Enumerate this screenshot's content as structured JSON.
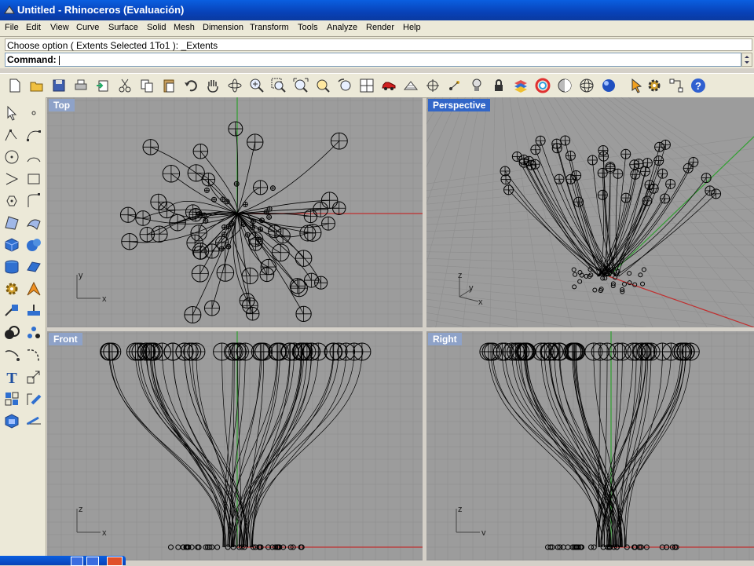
{
  "window": {
    "title": "Untitled - Rhinoceros (Evaluación)"
  },
  "menu": [
    "File",
    "Edit",
    "View",
    "Curve",
    "Surface",
    "Solid",
    "Mesh",
    "Dimension",
    "Transform",
    "Tools",
    "Analyze",
    "Render",
    "Help"
  ],
  "command": {
    "history": "Choose option ( Extents  Selected  1To1 ): _Extents",
    "prompt_label": "Command:",
    "value": ""
  },
  "toolbar_icons": [
    "new-icon",
    "open-icon",
    "save-icon",
    "print-icon",
    "import-icon",
    "cut-icon",
    "copy-icon",
    "paste-icon",
    "undo-icon",
    "pan-hand-icon",
    "rotate-view-icon",
    "zoom-in-icon",
    "zoom-window-icon",
    "zoom-extents-icon",
    "zoom-selected-icon",
    "undo-view-icon",
    "four-viewports-icon",
    "car-icon",
    "grid-icon",
    "osnap-icon",
    "points-icon",
    "light-icon",
    "lock-icon",
    "layer-icon",
    "color-wheel-icon",
    "shade-icon",
    "wireframe-sphere-icon",
    "render-sphere-icon",
    "select-arrow-icon",
    "settings-gear-icon",
    "history-icon",
    "help-icon"
  ],
  "left_toolbar_icons": [
    "select-arrow-icon",
    "point-icon",
    "polyline-icon",
    "curve-icon",
    "circle-icon",
    "arc-icon",
    "rectangle-icon",
    "fillet-icon",
    "polygon-icon",
    "curve-edit-icon",
    "surface-icon",
    "surface-edit-icon",
    "box-icon",
    "sphere-icon",
    "cylinder-icon",
    "extrude-icon",
    "gear-icon",
    "explode-icon",
    "split-icon",
    "trim-icon",
    "boolean-icon",
    "array-icon",
    "curve-dir-icon",
    "blend-icon",
    "text-icon",
    "scale-icon",
    "group-icon",
    "measure-icon",
    "solid-box-icon",
    "dimension-icon"
  ],
  "viewports": {
    "top": {
      "label": "Top",
      "axis_y": "y",
      "axis_x": "x"
    },
    "perspective": {
      "label": "Perspective",
      "axis_z": "z",
      "axis_y": "y",
      "axis_x": "x"
    },
    "front": {
      "label": "Front",
      "axis_z": "z",
      "axis_x": "x"
    },
    "right": {
      "label": "Right",
      "axis_z": "z",
      "axis_y": "y"
    }
  },
  "colors": {
    "viewport_bg": "#9c9c9c",
    "grid_minor": "#8e8e8e",
    "grid_major": "#7e7e7e",
    "x_axis": "#c03030",
    "y_axis": "#30a030",
    "active_label": "#3266c8",
    "inactive_label": "#8ea2c8"
  }
}
